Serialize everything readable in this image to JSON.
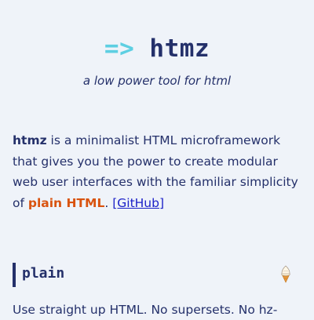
{
  "header": {
    "arrow": "=>",
    "name": "htmz",
    "tagline": "a low power tool for html"
  },
  "intro": {
    "brand": "htmz",
    "text1": " is a minimalist HTML microframework that gives you the power to create modular web user interfaces with the familiar simplicity of ",
    "plain_html": "plain HTML",
    "text2": ". ",
    "github_link": "[GitHub]"
  },
  "section": {
    "title": "plain",
    "icon": "ice-cream-icon",
    "body": "Use straight up HTML. No supersets. No hz-"
  },
  "colors": {
    "background": "#eff3f9",
    "text": "#24306a",
    "arrow": "#5dcfe2",
    "accent": "#d9530f",
    "link": "#1d22c8"
  }
}
